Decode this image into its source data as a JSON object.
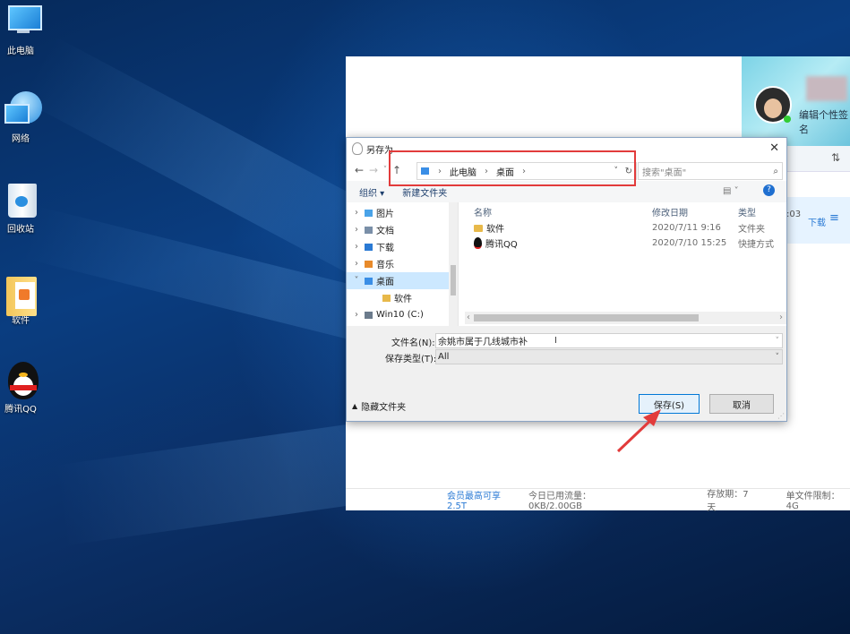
{
  "desktop": {
    "icons": [
      {
        "label": "此电脑",
        "icon": "computer-icon"
      },
      {
        "label": "网络",
        "icon": "network-icon"
      },
      {
        "label": "回收站",
        "icon": "recycle-bin-icon"
      },
      {
        "label": "软件",
        "icon": "folder-icon"
      },
      {
        "label": "腾讯QQ",
        "icon": "qq-icon"
      }
    ]
  },
  "background_app": {
    "signature_hint": "编辑个性签名",
    "time_fragment": ":03",
    "download_label": "下载",
    "footer": {
      "vip": "会员最高可享2.5T",
      "traffic": "今日已用流量：0KB/2.00GB",
      "storage": "存放期：7天",
      "limit": "单文件限制：4G"
    }
  },
  "dialog": {
    "title": "另存为",
    "breadcrumb": [
      "此电脑",
      "桌面"
    ],
    "search_placeholder": "搜索\"桌面\"",
    "toolbar": {
      "organize": "组织 ▾",
      "new_folder": "新建文件夹"
    },
    "nav_items": [
      {
        "label": "图片",
        "icon": "pictures-icon",
        "expander": "›",
        "selected": false
      },
      {
        "label": "文档",
        "icon": "documents-icon",
        "expander": "›",
        "selected": false
      },
      {
        "label": "下载",
        "icon": "downloads-icon",
        "expander": "›",
        "selected": false
      },
      {
        "label": "音乐",
        "icon": "music-icon",
        "expander": "›",
        "selected": false
      },
      {
        "label": "桌面",
        "icon": "desktop-folder-icon",
        "expander": "˅",
        "selected": true
      },
      {
        "label": "软件",
        "icon": "folder-icon",
        "expander": "",
        "selected": false
      },
      {
        "label": "Win10 (C:)",
        "icon": "drive-icon",
        "expander": "›",
        "selected": false
      }
    ],
    "columns": {
      "name": "名称",
      "date": "修改日期",
      "type": "类型"
    },
    "files": [
      {
        "name": "软件",
        "date": "2020/7/11 9:16",
        "type": "文件夹",
        "icon": "folder-icon"
      },
      {
        "name": "腾讯QQ",
        "date": "2020/7/10 15:25",
        "type": "快捷方式",
        "icon": "qq-icon"
      }
    ],
    "filename_label": "文件名(N):",
    "filename_value": "余姚市属于几线城市补",
    "filetype_label": "保存类型(T):",
    "filetype_value": "All",
    "hide_folders": "隐藏文件夹",
    "save_button": "保存(S)",
    "cancel_button": "取消"
  },
  "colors": {
    "highlight_box": "#e23b3b",
    "arrow": "#e23b3b",
    "selection": "#cce8ff"
  }
}
